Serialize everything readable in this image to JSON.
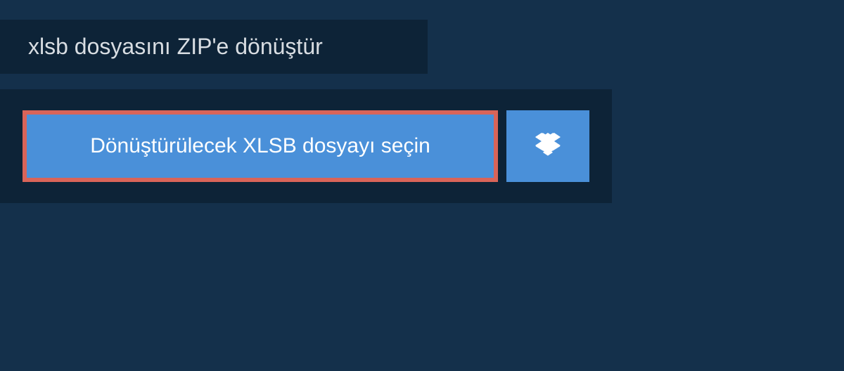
{
  "header": {
    "title": "xlsb dosyasını ZIP'e dönüştür"
  },
  "upload": {
    "select_label": "Dönüştürülecek XLSB dosyayı seçin"
  }
}
